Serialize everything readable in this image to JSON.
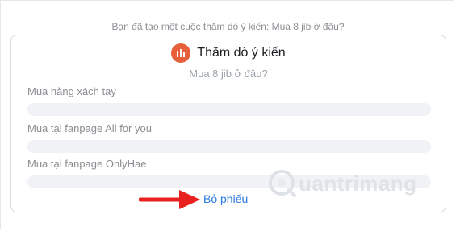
{
  "notice": "Bạn đã tạo một cuộc thăm dò ý kiến: Mua 8 jib ở đâu?",
  "poll": {
    "title": "Thăm dò ý kiến",
    "question": "Mua 8 jib ở đâu?",
    "options": [
      {
        "label": "Mua hàng xách tay",
        "share": 0
      },
      {
        "label": "Mua tại fanpage All for you",
        "share": 0
      },
      {
        "label": "Mua tại fanpage OnlyHae",
        "share": 0
      }
    ],
    "vote_button": "Bỏ phiếu"
  },
  "watermark": "uantrimang",
  "icons": {
    "poll": "bar-chart-icon",
    "arrow": "red-arrow-icon",
    "watermark": "quantrimang-logo"
  },
  "colors": {
    "poll_icon": "#e5603b",
    "vote_link": "#2a7ae2",
    "arrow": "#e8201e"
  }
}
